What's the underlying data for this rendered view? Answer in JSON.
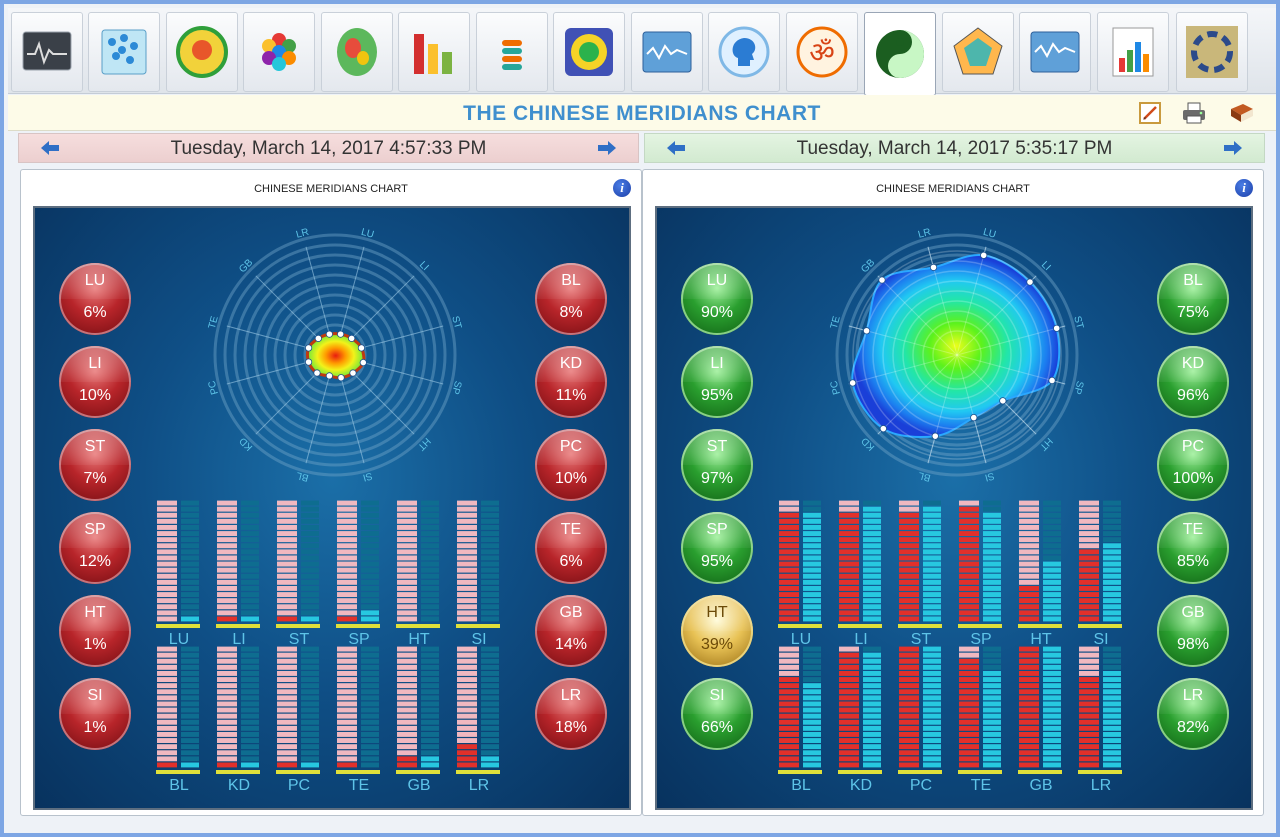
{
  "toolbar": {
    "buttons": [
      {
        "name": "ecg-monitor-icon"
      },
      {
        "name": "bubbles-icon"
      },
      {
        "name": "sphere-icon"
      },
      {
        "name": "hexagons-icon"
      },
      {
        "name": "brain-map-icon"
      },
      {
        "name": "bar-chart-icon"
      },
      {
        "name": "spine-icon"
      },
      {
        "name": "mandala-icon"
      },
      {
        "name": "waveform-icon"
      },
      {
        "name": "head-profile-icon"
      },
      {
        "name": "om-icon"
      },
      {
        "name": "yin-yang-icon"
      },
      {
        "name": "pentagon-radar-icon"
      },
      {
        "name": "waveform-2-icon"
      },
      {
        "name": "report-chart-icon"
      },
      {
        "name": "logo-knot-icon"
      }
    ],
    "active_index": 11
  },
  "header": {
    "title": "THE CHINESE MERIDIANS CHART"
  },
  "left": {
    "datetime": "Tuesday, March 14, 2017 4:57:33 PM",
    "panel_title": "CHINESE MERIDIANS CHART",
    "left_balls": [
      {
        "label": "LU",
        "value": "6%",
        "color": "red"
      },
      {
        "label": "LI",
        "value": "10%",
        "color": "red"
      },
      {
        "label": "ST",
        "value": "7%",
        "color": "red"
      },
      {
        "label": "SP",
        "value": "12%",
        "color": "red"
      },
      {
        "label": "HT",
        "value": "1%",
        "color": "red"
      },
      {
        "label": "SI",
        "value": "1%",
        "color": "red"
      }
    ],
    "right_balls": [
      {
        "label": "BL",
        "value": "8%",
        "color": "red"
      },
      {
        "label": "KD",
        "value": "11%",
        "color": "red"
      },
      {
        "label": "PC",
        "value": "10%",
        "color": "red"
      },
      {
        "label": "TE",
        "value": "6%",
        "color": "red"
      },
      {
        "label": "GB",
        "value": "14%",
        "color": "red"
      },
      {
        "label": "LR",
        "value": "18%",
        "color": "red"
      }
    ],
    "radar_axes": [
      "LU",
      "LI",
      "ST",
      "SP",
      "HT",
      "SI",
      "BL",
      "KD",
      "PC",
      "TE",
      "GB",
      "LR"
    ],
    "radar_values": [
      0.1,
      0.12,
      0.16,
      0.18,
      0.14,
      0.12,
      0.1,
      0.14,
      0.16,
      0.16,
      0.12,
      0.1
    ],
    "bar_top_labels": [
      "LU",
      "LI",
      "ST",
      "SP",
      "HT",
      "SI"
    ],
    "bar_top_red": [
      0.01,
      0.06,
      0.06,
      0.06,
      0.0,
      0.0
    ],
    "bar_top_cyan": [
      0.06,
      0.06,
      0.06,
      0.12,
      0.0,
      0.0
    ],
    "bar_bottom_labels": [
      "BL",
      "KD",
      "PC",
      "TE",
      "GB",
      "LR"
    ],
    "bar_bottom_red": [
      0.06,
      0.06,
      0.06,
      0.06,
      0.12,
      0.18
    ],
    "bar_bottom_cyan": [
      0.06,
      0.06,
      0.06,
      0.0,
      0.12,
      0.12
    ]
  },
  "right": {
    "datetime": "Tuesday, March 14, 2017 5:35:17 PM",
    "panel_title": "CHINESE MERIDIANS CHART",
    "left_balls": [
      {
        "label": "LU",
        "value": "90%",
        "color": "green"
      },
      {
        "label": "LI",
        "value": "95%",
        "color": "green"
      },
      {
        "label": "ST",
        "value": "97%",
        "color": "green"
      },
      {
        "label": "SP",
        "value": "95%",
        "color": "green"
      },
      {
        "label": "HT",
        "value": "39%",
        "color": "gold"
      },
      {
        "label": "SI",
        "value": "66%",
        "color": "green"
      }
    ],
    "right_balls": [
      {
        "label": "BL",
        "value": "75%",
        "color": "green"
      },
      {
        "label": "KD",
        "value": "96%",
        "color": "green"
      },
      {
        "label": "PC",
        "value": "100%",
        "color": "green"
      },
      {
        "label": "TE",
        "value": "85%",
        "color": "green"
      },
      {
        "label": "GB",
        "value": "98%",
        "color": "green"
      },
      {
        "label": "LR",
        "value": "82%",
        "color": "green"
      }
    ],
    "radar_axes": [
      "LU",
      "LI",
      "ST",
      "SP",
      "HT",
      "SI",
      "BL",
      "KD",
      "PC",
      "TE",
      "GB",
      "LR"
    ],
    "radar_values": [
      0.95,
      0.95,
      0.95,
      0.9,
      0.55,
      0.55,
      0.75,
      0.96,
      1.0,
      0.85,
      0.98,
      0.82
    ],
    "bar_top_labels": [
      "LU",
      "LI",
      "ST",
      "SP",
      "HT",
      "SI"
    ],
    "bar_top_red": [
      0.9,
      0.9,
      0.9,
      0.95,
      0.3,
      0.6
    ],
    "bar_top_cyan": [
      0.9,
      0.95,
      0.97,
      0.9,
      0.5,
      0.66
    ],
    "bar_bottom_labels": [
      "BL",
      "KD",
      "PC",
      "TE",
      "GB",
      "LR"
    ],
    "bar_bottom_red": [
      0.75,
      0.96,
      1.0,
      0.9,
      0.98,
      0.75
    ],
    "bar_bottom_cyan": [
      0.7,
      0.96,
      1.0,
      0.8,
      0.98,
      0.82
    ]
  }
}
